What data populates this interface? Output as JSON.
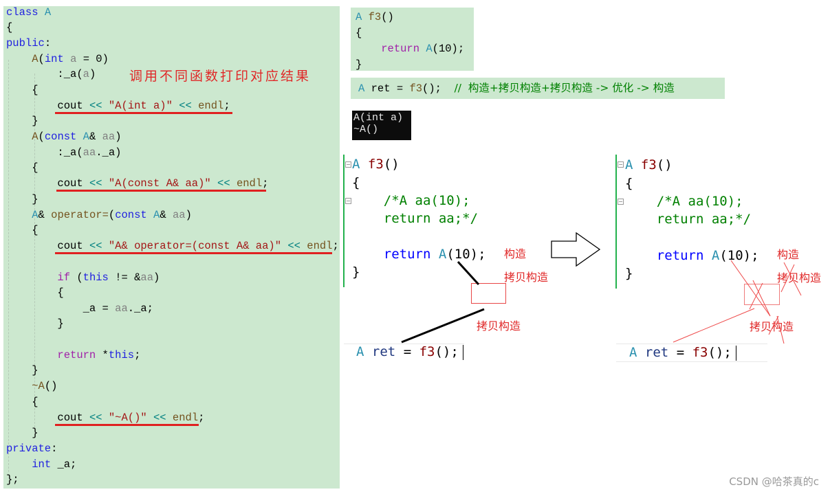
{
  "left_code": {
    "lines": [
      "class A",
      "{",
      "public:",
      "    A(int a = 0)",
      "        :_a(a)",
      "    {",
      "        cout << \"A(int a)\" << endl;",
      "    }",
      "    A(const A& aa)",
      "        :_a(aa._a)",
      "    {",
      "        cout << \"A(const A& aa)\" << endl;",
      "    }",
      "    A& operator=(const A& aa)",
      "    {",
      "        cout << \"A& operator=(const A& aa)\" << endl;",
      "",
      "        if (this != &aa)",
      "        {",
      "            _a = aa._a;",
      "        }",
      "",
      "        return *this;",
      "    }",
      "    ~A()",
      "    {",
      "        cout << \"~A()\" << endl;",
      "    }",
      "private:",
      "    int _a;",
      "};"
    ],
    "annotation": "调用不同函数打印对应结果"
  },
  "f3_snippet": {
    "lines": [
      "A f3()",
      "{",
      "    return A(10);",
      "}"
    ]
  },
  "ret_comment": "A ret = f3();  //  构造+拷贝构造+拷贝构造 -> 优化 -> 构造",
  "console_output": [
    "A(int a)",
    "~A()"
  ],
  "diagram_left": {
    "code": [
      "A f3()",
      "{",
      "    /*A aa(10);",
      "    return aa;*/",
      "",
      "    return A(10);",
      "}"
    ],
    "label_construct": "构造",
    "label_copy1": "拷贝构造",
    "label_copy2": "拷贝构造",
    "ret_line": "A ret = f3();"
  },
  "diagram_right": {
    "code": [
      "A f3()",
      "{",
      "    /*A aa(10);",
      "    return aa;*/",
      "",
      "    return A(10);",
      "}"
    ],
    "label_construct": "构造",
    "label_copy1": "拷贝构造",
    "label_copy2": "拷贝构造",
    "ret_line": "A ret = f3();"
  },
  "watermark": "CSDN @哈茶真的c",
  "colors": {
    "editor_bg": "#cce8cf",
    "annotation_red": "#e02828",
    "change_bar_green": "#22b14c"
  }
}
